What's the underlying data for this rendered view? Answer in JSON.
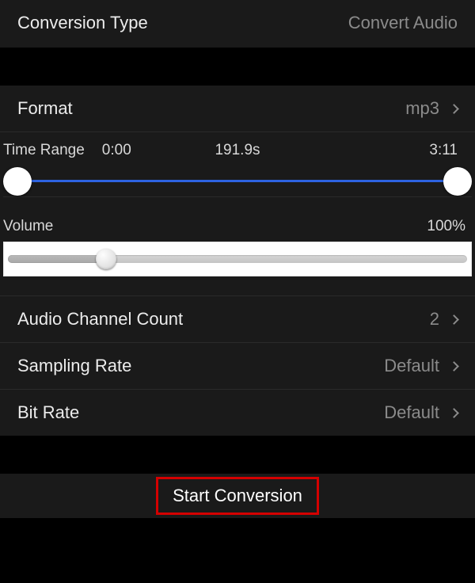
{
  "header": {
    "title": "Conversion Type",
    "value": "Convert Audio"
  },
  "format": {
    "label": "Format",
    "value": "mp3"
  },
  "timerange": {
    "label": "Time Range",
    "start": "0:00",
    "duration": "191.9s",
    "end": "3:11"
  },
  "volume": {
    "label": "Volume",
    "value": "100%"
  },
  "channels": {
    "label": "Audio Channel Count",
    "value": "2"
  },
  "sampling": {
    "label": "Sampling Rate",
    "value": "Default"
  },
  "bitrate": {
    "label": "Bit Rate",
    "value": "Default"
  },
  "startButton": "Start Conversion"
}
